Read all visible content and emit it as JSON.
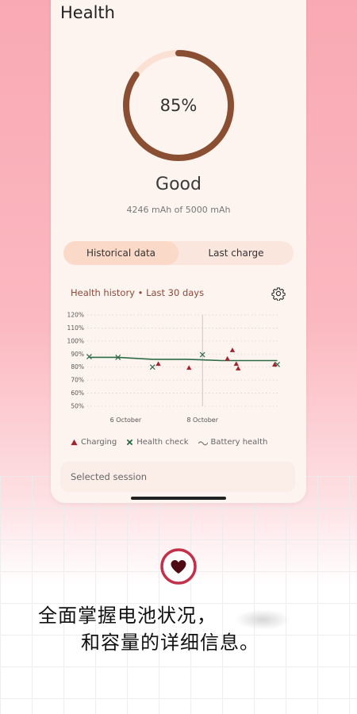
{
  "header": {
    "title": "Health"
  },
  "health": {
    "percent_value": 0.85,
    "percent_label": "85%",
    "status": "Good",
    "capacity_text": "4246 mAh of 5000 mAh"
  },
  "tabs": [
    {
      "label": "Historical data",
      "active": true
    },
    {
      "label": "Last charge",
      "active": false
    }
  ],
  "history": {
    "title": "Health history • Last 30 days",
    "selected_session": "Selected session",
    "legend": {
      "charging": "Charging",
      "health_check": "Health check",
      "battery_health": "Battery health"
    }
  },
  "colors": {
    "ring_fill": "#8a4f32",
    "ring_track": "#fbe0d4",
    "accent_red": "#a0232f",
    "accent_green": "#2c6b45",
    "heart": "#4e0b13",
    "heart_ring": "#c2304a"
  },
  "promo": {
    "line1": "全面掌握电池状况，",
    "line2": "和容量的详细信息。"
  },
  "icons": {
    "settings": "gear-icon",
    "heart": "heart-icon"
  },
  "chart_data": {
    "type": "scatter",
    "yticks": [
      "120%",
      "110%",
      "100%",
      "90%",
      "80%",
      "70%",
      "60%",
      "50%"
    ],
    "ylim": [
      50,
      120
    ],
    "xtick_labels": [
      {
        "label": "6 October",
        "x": 1
      },
      {
        "label": "8 October",
        "x": 3
      }
    ],
    "xlim": [
      0,
      5
    ],
    "series": [
      {
        "name": "Battery health",
        "kind": "line",
        "points": [
          [
            0.05,
            87.5
          ],
          [
            0.8,
            87.5
          ],
          [
            1.7,
            86
          ],
          [
            2.6,
            86
          ],
          [
            3.5,
            85
          ],
          [
            4.4,
            85
          ],
          [
            4.95,
            85
          ]
        ]
      },
      {
        "name": "Health check",
        "kind": "cross",
        "points": [
          [
            0.05,
            88
          ],
          [
            0.8,
            87.5
          ],
          [
            1.7,
            80
          ],
          [
            3,
            89.5
          ],
          [
            4.95,
            82
          ]
        ]
      },
      {
        "name": "Charging",
        "kind": "triangle",
        "points": [
          [
            1.85,
            82.5
          ],
          [
            2.65,
            79.5
          ],
          [
            3.65,
            86.5
          ],
          [
            3.78,
            93
          ],
          [
            3.88,
            82.5
          ],
          [
            3.93,
            79
          ],
          [
            4.88,
            82
          ]
        ]
      }
    ]
  }
}
